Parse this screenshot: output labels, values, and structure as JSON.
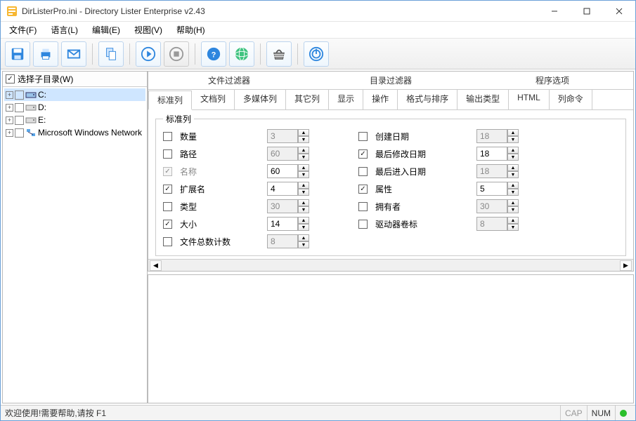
{
  "window": {
    "title": "DirListerPro.ini - Directory Lister Enterprise v2.43"
  },
  "menu": {
    "file": "文件(F)",
    "language": "语言(L)",
    "edit": "编辑(E)",
    "view": "视图(V)",
    "help": "帮助(H)"
  },
  "toolbar_icons": [
    "save",
    "print",
    "mail",
    "copy",
    "play",
    "stop",
    "help",
    "globe",
    "basket",
    "power"
  ],
  "left": {
    "header_label": "选择子目录(W)",
    "nodes": [
      {
        "label": "C:",
        "selected": true,
        "type": "drive"
      },
      {
        "label": "D:",
        "selected": false,
        "type": "drive"
      },
      {
        "label": "E:",
        "selected": false,
        "type": "drive"
      },
      {
        "label": "Microsoft Windows Network",
        "selected": false,
        "type": "network"
      }
    ]
  },
  "topTabs": {
    "a": "文件过滤器",
    "b": "目录过滤器",
    "c": "程序选项"
  },
  "subTabs": {
    "t1": "标准列",
    "t2": "文档列",
    "t3": "多媒体列",
    "t4": "其它列",
    "t5": "显示",
    "t6": "操作",
    "t7": "格式与排序",
    "t8": "输出类型",
    "t9": "HTML",
    "t10": "列命令"
  },
  "panel": {
    "legend": "标准列",
    "rows": [
      {
        "l_chk": false,
        "l_lbl": "数量",
        "l_val": "3",
        "l_en": false,
        "r_chk": false,
        "r_lbl": "创建日期",
        "r_val": "18",
        "r_en": false
      },
      {
        "l_chk": false,
        "l_lbl": "路径",
        "l_val": "60",
        "l_en": false,
        "r_chk": true,
        "r_lbl": "最后修改日期",
        "r_val": "18",
        "r_en": true
      },
      {
        "l_chk": true,
        "l_dis": true,
        "l_lbl": "名称",
        "l_val": "60",
        "l_en": true,
        "r_chk": false,
        "r_lbl": "最后进入日期",
        "r_val": "18",
        "r_en": false
      },
      {
        "l_chk": true,
        "l_lbl": "扩展名",
        "l_val": "4",
        "l_en": true,
        "r_chk": true,
        "r_lbl": "属性",
        "r_val": "5",
        "r_en": true
      },
      {
        "l_chk": false,
        "l_lbl": "类型",
        "l_val": "30",
        "l_en": false,
        "r_chk": false,
        "r_lbl": "拥有者",
        "r_val": "30",
        "r_en": false
      },
      {
        "l_chk": true,
        "l_lbl": "大小",
        "l_val": "14",
        "l_en": true,
        "r_chk": false,
        "r_lbl": "驱动器卷标",
        "r_val": "8",
        "r_en": false
      },
      {
        "l_chk": false,
        "l_lbl": "文件总数计数",
        "l_val": "8",
        "l_en": false
      }
    ]
  },
  "status": {
    "left": "欢迎使用!需要帮助,请按 F1",
    "cap": "CAP",
    "num": "NUM"
  }
}
